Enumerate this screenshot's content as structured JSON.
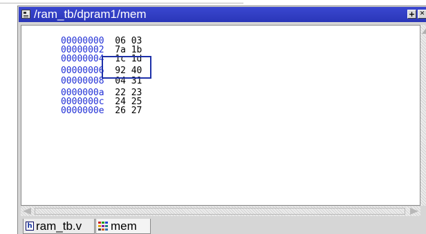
{
  "window": {
    "title": "/ram_tb/dpram1/mem",
    "title_icon": "memory-window-icon",
    "buttons": [
      {
        "name": "dock-button",
        "glyph": "+"
      },
      {
        "name": "close-button",
        "glyph": "✕"
      }
    ],
    "colors": {
      "titlebar": "#2f3cc6",
      "address": "#1f2ed6",
      "highlight_box": "#1c2fa8"
    }
  },
  "memory": {
    "rows": [
      {
        "address": "00000000",
        "values": "06 03"
      },
      {
        "address": "00000002",
        "values": "7a 1b"
      },
      {
        "address": "00000004",
        "values": "1c 1d"
      },
      {
        "address": "00000006",
        "values": "92 40"
      },
      {
        "address": "00000008",
        "values": "04 31"
      },
      {
        "address": "0000000a",
        "values": "22 23"
      },
      {
        "address": "0000000c",
        "values": "24 25"
      },
      {
        "address": "0000000e",
        "values": "26 27"
      }
    ],
    "highlighted_rows": [
      "00000006",
      "00000008"
    ]
  },
  "tabs": [
    {
      "label": "ram_tb.v",
      "icon": "verilog-file-icon"
    },
    {
      "label": "mem",
      "icon": "memory-grid-icon"
    }
  ]
}
